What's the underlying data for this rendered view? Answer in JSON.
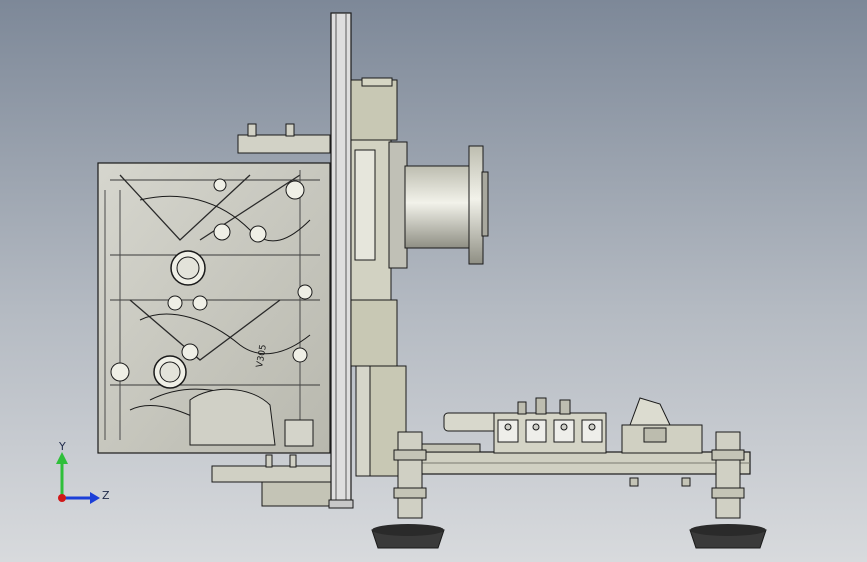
{
  "part_label": "V305",
  "triad": {
    "y_label": "Y",
    "z_label": "Z",
    "colors": {
      "y": "#2fbf3a",
      "z": "#1b3fd8",
      "x": "#d01818"
    }
  },
  "colors": {
    "background_top": "#7d8898",
    "background_bottom": "#d8dadd",
    "metal": "#e2e2dc",
    "frame": "#c8c8b4",
    "dark": "#1a1a1a"
  }
}
